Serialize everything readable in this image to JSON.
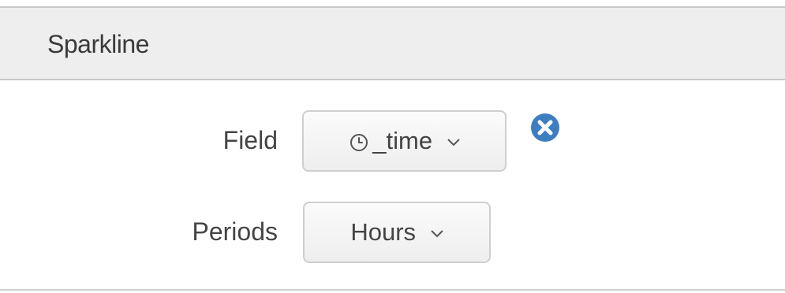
{
  "header": {
    "title": "Sparkline"
  },
  "form": {
    "field": {
      "label": "Field",
      "value": "_time",
      "icon": "clock-icon"
    },
    "periods": {
      "label": "Periods",
      "value": "Hours"
    },
    "remove_icon": "close-circle-icon"
  },
  "colors": {
    "remove_icon": "#3d7ec1",
    "header_bg": "#eeeeee"
  }
}
